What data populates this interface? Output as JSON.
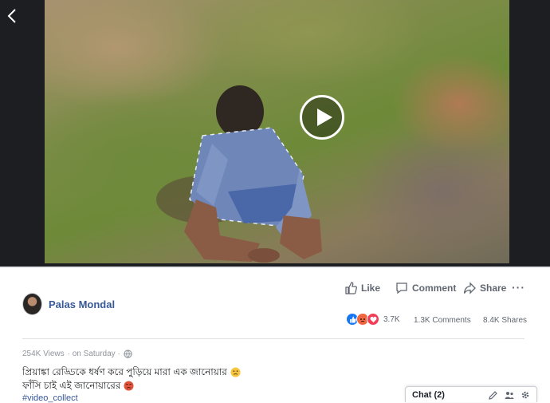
{
  "video": {
    "back_icon": "chevron-left-icon",
    "play_icon": "play-icon"
  },
  "actions": {
    "like_label": "Like",
    "comment_label": "Comment",
    "share_label": "Share",
    "more_label": "···"
  },
  "author": {
    "name": "Palas Mondal"
  },
  "stats": {
    "reactions_count": "3.7K",
    "comments": "1.3K Comments",
    "shares": "8.4K Shares",
    "reaction_types": [
      "like",
      "angry",
      "love"
    ]
  },
  "post": {
    "views": "254K Views",
    "time": "· on Saturday ·",
    "line1": "প্রিয়াঙ্কা রেড্ডিকে ধর্ষণ করে পুড়িয়ে মারা এক জানোয়ার",
    "line2": "ফাঁসি চাই এই জানোয়ারের",
    "hashtags": "#video_collect"
  },
  "chat": {
    "label": "Chat (2)"
  },
  "colors": {
    "link": "#385898",
    "text_secondary": "#606770",
    "like_blue": "#1877f2",
    "angry_orange": "#f0663f",
    "love_red": "#f33e58"
  }
}
